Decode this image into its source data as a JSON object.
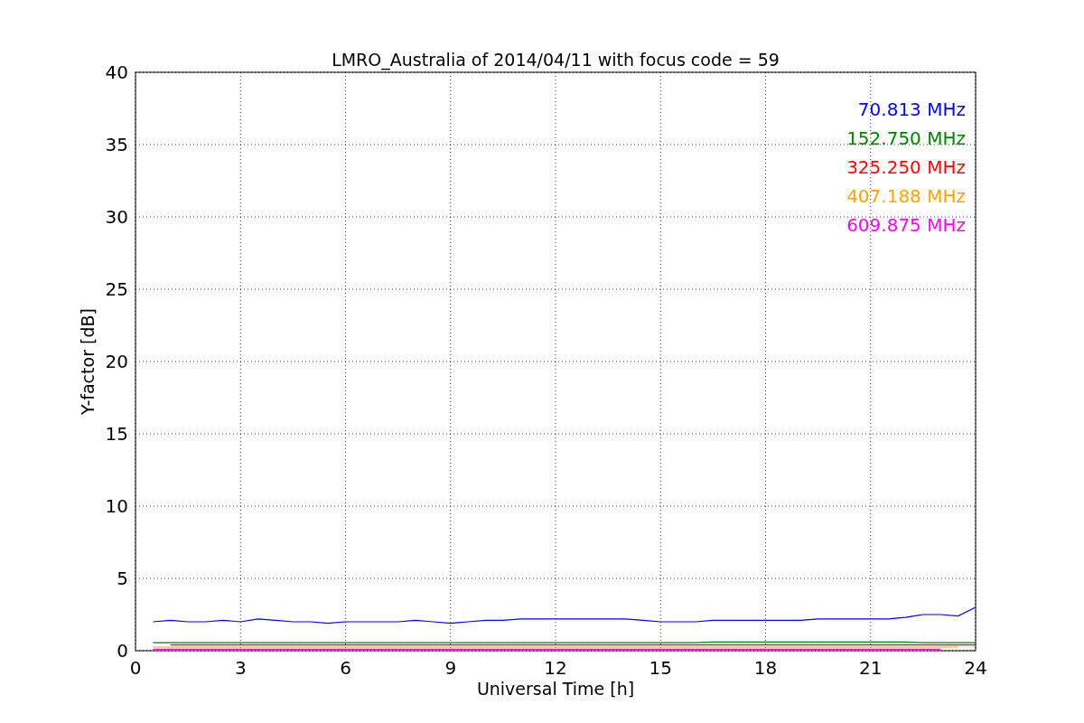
{
  "figure": {
    "chart_data": {
      "type": "line",
      "title": "LMRO_Australia of 2014/04/11 with focus code = 59",
      "xlabel": "Universal Time [h]",
      "ylabel": "Y-factor [dB]",
      "grid": true,
      "x": [
        0.5,
        1,
        1.5,
        2,
        2.5,
        3,
        3.5,
        4,
        4.5,
        5,
        5.5,
        6,
        6.5,
        7,
        7.5,
        8,
        8.5,
        9,
        9.5,
        10,
        10.5,
        11,
        11.5,
        12,
        12.5,
        13,
        13.5,
        14,
        14.5,
        15,
        15.5,
        16,
        16.5,
        17,
        17.5,
        18,
        18.5,
        19,
        19.5,
        20,
        20.5,
        21,
        21.5,
        22,
        22.5,
        23,
        23.5,
        24
      ],
      "series": [
        {
          "name": "70.813 MHz",
          "color": "#0000ff",
          "values": [
            2.0,
            2.1,
            2.0,
            2.0,
            2.1,
            2.0,
            2.2,
            2.1,
            2.0,
            2.0,
            1.9,
            2.0,
            2.0,
            2.0,
            2.0,
            2.1,
            2.0,
            1.9,
            2.0,
            2.1,
            2.1,
            2.2,
            2.2,
            2.2,
            2.2,
            2.2,
            2.2,
            2.2,
            2.1,
            2.0,
            2.0,
            2.0,
            2.1,
            2.1,
            2.1,
            2.1,
            2.1,
            2.1,
            2.2,
            2.2,
            2.2,
            2.2,
            2.2,
            2.3,
            2.5,
            2.5,
            2.4,
            3.0
          ]
        },
        {
          "name": "152.750 MHz",
          "color": "#008000",
          "values": [
            0.55,
            0.55,
            0.55,
            0.55,
            0.55,
            0.55,
            0.55,
            0.55,
            0.55,
            0.55,
            0.55,
            0.55,
            0.55,
            0.55,
            0.55,
            0.55,
            0.55,
            0.55,
            0.55,
            0.55,
            0.55,
            0.55,
            0.55,
            0.55,
            0.55,
            0.55,
            0.55,
            0.55,
            0.55,
            0.55,
            0.55,
            0.55,
            0.6,
            0.6,
            0.6,
            0.6,
            0.6,
            0.6,
            0.6,
            0.6,
            0.6,
            0.6,
            0.6,
            0.6,
            0.55,
            0.55,
            0.55,
            0.55
          ]
        },
        {
          "name": "325.250 MHz",
          "color": "#ff0000",
          "values": [
            null,
            0.4,
            0.4,
            0.4,
            0.4,
            0.4,
            0.4,
            0.4,
            0.4,
            0.4,
            0.4,
            0.4,
            0.4,
            0.4,
            0.4,
            0.4,
            0.4,
            0.4,
            0.4,
            0.4,
            0.4,
            0.4,
            0.4,
            0.4,
            0.4,
            0.4,
            0.4,
            0.4,
            0.4,
            0.4,
            0.4,
            0.4,
            0.4,
            0.4,
            0.4,
            0.4,
            0.4,
            0.4,
            0.4,
            0.4,
            0.4,
            0.4,
            0.4,
            0.4,
            0.4,
            0.4,
            0.4,
            0.4
          ]
        },
        {
          "name": "407.188 MHz",
          "color": "#ffa500",
          "values": [
            0.25,
            0.25,
            0.25,
            0.25,
            0.25,
            0.25,
            0.25,
            0.25,
            0.25,
            0.25,
            0.25,
            0.25,
            0.25,
            0.25,
            0.25,
            0.25,
            0.25,
            0.25,
            0.25,
            0.25,
            0.25,
            0.25,
            0.25,
            0.25,
            0.25,
            0.25,
            0.25,
            0.25,
            0.25,
            0.25,
            0.25,
            0.25,
            0.25,
            0.25,
            0.25,
            0.25,
            0.25,
            0.25,
            0.25,
            0.25,
            0.25,
            0.25,
            0.25,
            0.25,
            0.25,
            0.25,
            0.25,
            null
          ]
        },
        {
          "name": "609.875 MHz",
          "color": "#ff00ff",
          "values": [
            0.1,
            0.1,
            0.1,
            0.1,
            0.1,
            0.1,
            0.1,
            0.1,
            0.1,
            0.1,
            0.1,
            0.1,
            0.1,
            0.1,
            0.1,
            0.1,
            0.1,
            0.1,
            0.1,
            0.1,
            0.1,
            0.1,
            0.1,
            0.1,
            0.1,
            0.1,
            0.1,
            0.1,
            0.1,
            0.1,
            0.1,
            0.1,
            0.1,
            0.1,
            0.1,
            0.1,
            0.1,
            0.1,
            0.1,
            0.1,
            0.1,
            0.1,
            0.1,
            0.1,
            0.1,
            0.1,
            null,
            null
          ]
        }
      ],
      "xlim": [
        0,
        24
      ],
      "ylim": [
        0,
        40
      ],
      "xticks": [
        0,
        3,
        6,
        9,
        12,
        15,
        18,
        21,
        24
      ],
      "yticks": [
        0,
        5,
        10,
        15,
        20,
        25,
        30,
        35,
        40
      ]
    }
  }
}
